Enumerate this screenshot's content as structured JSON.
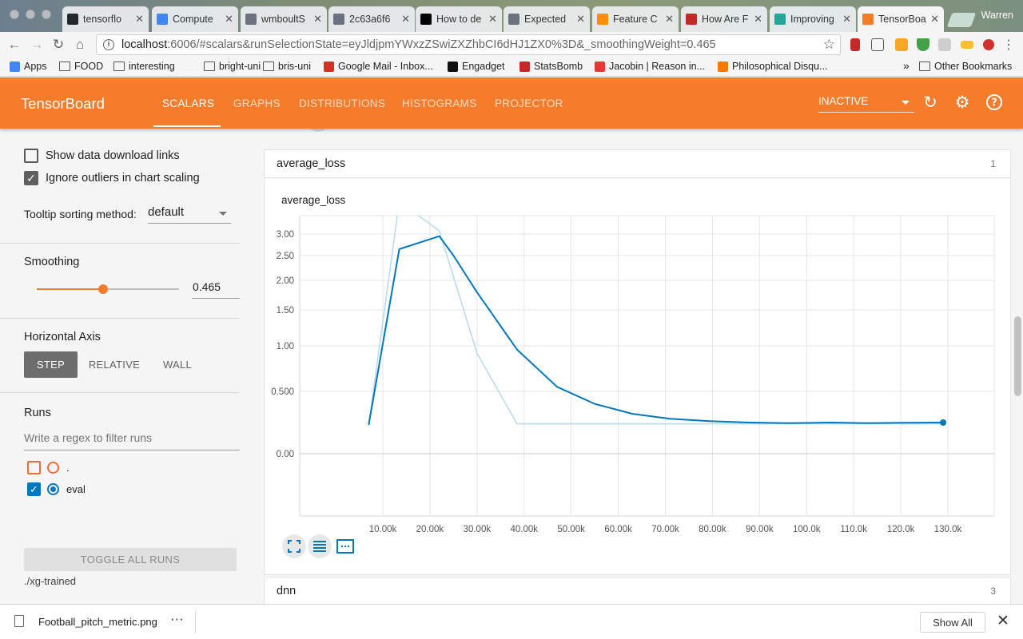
{
  "browser": {
    "tabs": [
      {
        "label": "tensorflo",
        "icon": "github-icon",
        "color": "#24292e"
      },
      {
        "label": "Compute",
        "icon": "chip-icon",
        "color": "#4285f4"
      },
      {
        "label": "wmboultS",
        "icon": "gear-icon",
        "color": "#6a737d"
      },
      {
        "label": "2c63a6f6",
        "icon": "document-icon",
        "color": "#6a737d"
      },
      {
        "label": "How to de",
        "icon": "medium-icon",
        "color": "#000000"
      },
      {
        "label": "Expected",
        "icon": "document-icon",
        "color": "#6a737d"
      },
      {
        "label": "Feature C",
        "icon": "tensorflow-icon",
        "color": "#ff8f00"
      },
      {
        "label": "How Are F",
        "icon": "statsbomb-icon",
        "color": "#c62828"
      },
      {
        "label": "Improving",
        "icon": "chart-icon",
        "color": "#26a69a"
      },
      {
        "label": "TensorBoa",
        "icon": "tensorboard-icon",
        "color": "#f57c2a"
      }
    ],
    "profile": "Warren",
    "url_host": "localhost",
    "url_rest": ":6006/#scalars&runSelectionState=eyJldjpmYWxzZSwiZXZhbCI6dHJ1ZX0%3D&_smoothingWeight=0.465",
    "bookmarks": [
      {
        "label": "Apps",
        "icon": "apps-icon"
      },
      {
        "label": "FOOD",
        "icon": "folder-icon"
      },
      {
        "label": "interesting",
        "icon": "folder-icon"
      },
      {
        "label": "bright-uni",
        "icon": "folder-icon"
      },
      {
        "label": "bris-uni",
        "icon": "folder-icon"
      },
      {
        "label": "Google Mail - Inbox...",
        "icon": "gmail-icon"
      },
      {
        "label": "Engadget",
        "icon": "engadget-icon"
      },
      {
        "label": "StatsBomb",
        "icon": "statsbomb-icon"
      },
      {
        "label": "Jacobin | Reason in...",
        "icon": "jacobin-icon"
      },
      {
        "label": "Philosophical Disqu...",
        "icon": "blogger-icon"
      }
    ],
    "other_bookmarks": "Other Bookmarks",
    "overflow_chevron": "»"
  },
  "header": {
    "title": "TensorBoard",
    "tabs": [
      "SCALARS",
      "GRAPHS",
      "DISTRIBUTIONS",
      "HISTOGRAMS",
      "PROJECTOR"
    ],
    "active_tab": "SCALARS",
    "run_status": "INACTIVE"
  },
  "sidebar": {
    "show_download": "Show data download links",
    "ignore_outliers": "Ignore outliers in chart scaling",
    "tooltip_label": "Tooltip sorting method:",
    "tooltip_value": "default",
    "smoothing_label": "Smoothing",
    "smoothing_value": "0.465",
    "smoothing_fraction": 0.465,
    "haxis_label": "Horizontal Axis",
    "haxis_options": [
      "STEP",
      "RELATIVE",
      "WALL"
    ],
    "haxis_active": "STEP",
    "runs_label": "Runs",
    "runs_filter_placeholder": "Write a regex to filter runs",
    "runs": [
      {
        "name": ".",
        "checked": false,
        "color": "#ef6c3a"
      },
      {
        "name": "eval",
        "checked": true,
        "color": "#0277bd"
      }
    ],
    "toggle_all": "TOGGLE ALL RUNS",
    "logdir": "./xg-trained"
  },
  "main": {
    "group1_name": "average_loss",
    "group1_count": "1",
    "group2_name": "dnn",
    "group2_count": "3",
    "card_title": "average_loss"
  },
  "chart_data": {
    "type": "line",
    "title": "average_loss",
    "xlabel": "",
    "ylabel": "",
    "x_ticks": [
      "10.00k",
      "20.00k",
      "30.00k",
      "40.00k",
      "50.00k",
      "60.00k",
      "70.00k",
      "80.00k",
      "90.00k",
      "100.0k",
      "110.0k",
      "120.0k",
      "130.0k"
    ],
    "y_ticks": [
      "0.00",
      "0.500",
      "1.00",
      "1.50",
      "2.00",
      "2.50",
      "3.00"
    ],
    "grid": true,
    "series": [
      {
        "name": "eval",
        "kind": "raw",
        "color": "#bcdcec",
        "x": [
          7000,
          13500,
          22000,
          30000,
          38500,
          129000
        ],
        "y": [
          0.23,
          4.5,
          3.15,
          0.92,
          0.24,
          0.24
        ]
      },
      {
        "name": "eval",
        "kind": "smoothed",
        "color": "#0277bd",
        "x": [
          7000,
          13500,
          22000,
          25000,
          30000,
          38500,
          47000,
          55000,
          63000,
          71000,
          80000,
          88000,
          96000,
          105000,
          113000,
          121000,
          129000
        ],
        "y": [
          0.23,
          2.65,
          2.95,
          2.5,
          1.8,
          0.96,
          0.55,
          0.4,
          0.32,
          0.28,
          0.26,
          0.25,
          0.245,
          0.25,
          0.245,
          0.248,
          0.25
        ],
        "end_marker": true
      }
    ]
  }
}
